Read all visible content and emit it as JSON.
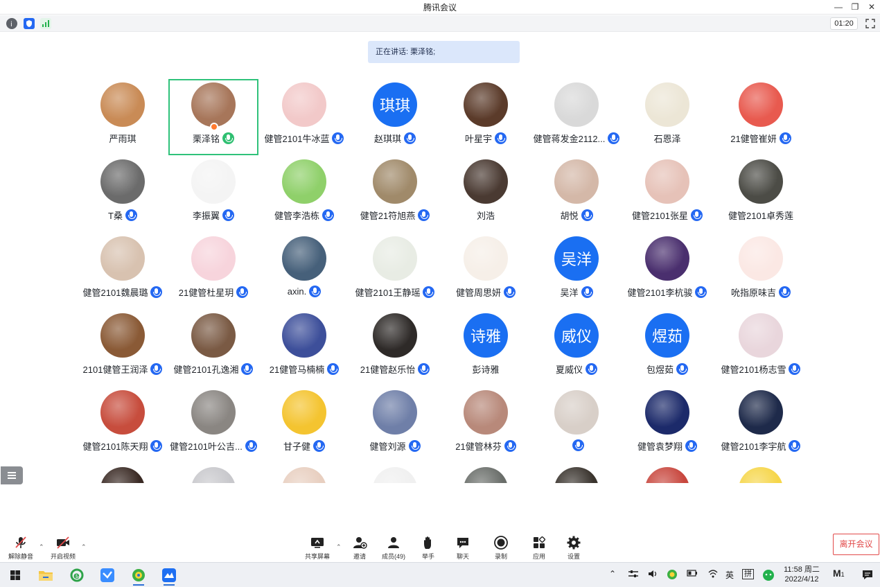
{
  "window": {
    "title": "腾讯会议"
  },
  "status": {
    "timer": "01:20"
  },
  "speaking": {
    "text": "正在讲话: 栗泽铭;"
  },
  "participants": [
    {
      "name": "严雨琪",
      "avatar": "photo",
      "color": "#c98b56",
      "mic": false
    },
    {
      "name": "栗泽铭",
      "avatar": "photo",
      "color": "#a7765a",
      "mic": true,
      "speaking": true,
      "active": true
    },
    {
      "name": "健管2101牛冰蓝",
      "avatar": "photo",
      "color": "#f2c9c9",
      "mic": true
    },
    {
      "name": "赵琪琪",
      "avatar": "text",
      "text": "琪琪",
      "color": "#1a6ff2",
      "mic": true
    },
    {
      "name": "叶星宇",
      "avatar": "photo",
      "color": "#5b3b2a",
      "mic": true
    },
    {
      "name": "健管蒋发金2112...",
      "avatar": "photo",
      "color": "#d9d9d9",
      "mic": true
    },
    {
      "name": "石恩泽",
      "avatar": "photo",
      "color": "#ece6d6",
      "mic": false
    },
    {
      "name": "21健管崔妍",
      "avatar": "photo",
      "color": "#e85a4f",
      "mic": true
    },
    {
      "name": "T桑",
      "avatar": "photo",
      "color": "#6b6b6b",
      "mic": true
    },
    {
      "name": "李振翼",
      "avatar": "photo",
      "color": "#f4f4f4",
      "mic": true
    },
    {
      "name": "健管李浩栋",
      "avatar": "photo",
      "color": "#8fd06a",
      "mic": true
    },
    {
      "name": "健管21符旭燕",
      "avatar": "photo",
      "color": "#a08a6a",
      "mic": true
    },
    {
      "name": "刘浩",
      "avatar": "photo",
      "color": "#4a3a32",
      "mic": false
    },
    {
      "name": "胡悦",
      "avatar": "photo",
      "color": "#d4b8a8",
      "mic": true
    },
    {
      "name": "健管2101张星",
      "avatar": "photo",
      "color": "#e6c2b8",
      "mic": true
    },
    {
      "name": "健管2101卓秀莲",
      "avatar": "photo",
      "color": "#4c4c46",
      "mic": false
    },
    {
      "name": "健管2101魏晨璐",
      "avatar": "photo",
      "color": "#d8c2b0",
      "mic": true
    },
    {
      "name": "21健管杜星玥",
      "avatar": "photo",
      "color": "#f7d4dc",
      "mic": true
    },
    {
      "name": "axin.",
      "avatar": "photo",
      "color": "#46607a",
      "mic": true
    },
    {
      "name": "健管2101王静瑶",
      "avatar": "photo",
      "color": "#e8ece4",
      "mic": true
    },
    {
      "name": "健管周思妍",
      "avatar": "photo",
      "color": "#f6efe8",
      "mic": true
    },
    {
      "name": "吴洋",
      "avatar": "text",
      "text": "吴洋",
      "color": "#1a6ff2",
      "mic": true
    },
    {
      "name": "健管2101李杭骏",
      "avatar": "photo",
      "color": "#4a2f6e",
      "mic": true
    },
    {
      "name": "吮指原味吉",
      "avatar": "photo",
      "color": "#fbe8e4",
      "mic": true
    },
    {
      "name": "2101健管王润泽",
      "avatar": "photo",
      "color": "#8a5a36",
      "mic": true
    },
    {
      "name": "健管2101孔逸湘",
      "avatar": "photo",
      "color": "#7a5a44",
      "mic": true
    },
    {
      "name": "21健管马楠楠",
      "avatar": "photo",
      "color": "#3d4f9a",
      "mic": true
    },
    {
      "name": "21健管赵乐怡",
      "avatar": "photo",
      "color": "#2e2a28",
      "mic": true
    },
    {
      "name": "彭诗雅",
      "avatar": "text",
      "text": "诗雅",
      "color": "#1a6ff2",
      "mic": false
    },
    {
      "name": "夏威仪",
      "avatar": "text",
      "text": "威仪",
      "color": "#1a6ff2",
      "mic": true
    },
    {
      "name": "包煜茹",
      "avatar": "text",
      "text": "煜茹",
      "color": "#1a6ff2",
      "mic": true
    },
    {
      "name": "健管2101杨志雪",
      "avatar": "photo",
      "color": "#e9d6dc",
      "mic": true
    },
    {
      "name": "健管2101陈天翔",
      "avatar": "photo",
      "color": "#c74d3d",
      "mic": true
    },
    {
      "name": "健管2101叶公吉...",
      "avatar": "photo",
      "color": "#8a8682",
      "mic": true
    },
    {
      "name": "甘子健",
      "avatar": "photo",
      "color": "#f4c430",
      "mic": true
    },
    {
      "name": "健管刘源",
      "avatar": "photo",
      "color": "#6f7fa8",
      "mic": true
    },
    {
      "name": "21健管林芬",
      "avatar": "photo",
      "color": "#b8897a",
      "mic": true
    },
    {
      "name": "",
      "avatar": "photo",
      "color": "#d8cfc8",
      "mic": true
    },
    {
      "name": "健管袁梦翔",
      "avatar": "photo",
      "color": "#1c2a6a",
      "mic": true,
      "micSolid": true
    },
    {
      "name": "健管2101李宇航",
      "avatar": "photo",
      "color": "#1e2a4a",
      "mic": true
    },
    {
      "name": "",
      "avatar": "photo",
      "color": "#3a2a24",
      "mic": false
    },
    {
      "name": "",
      "avatar": "photo",
      "color": "#c8c8cc",
      "mic": false
    },
    {
      "name": "",
      "avatar": "photo",
      "color": "#e8cfc0",
      "mic": false
    },
    {
      "name": "",
      "avatar": "photo",
      "color": "#f0f0f0",
      "mic": false
    },
    {
      "name": "",
      "avatar": "photo",
      "color": "#6a6e6a",
      "mic": false
    },
    {
      "name": "",
      "avatar": "photo",
      "color": "#3a342e",
      "mic": false
    },
    {
      "name": "",
      "avatar": "photo",
      "color": "#c8473e",
      "mic": false
    },
    {
      "name": "",
      "avatar": "photo",
      "color": "#f6d64a",
      "mic": false
    }
  ],
  "toolbar": {
    "unmute": "解除静音",
    "start_video": "开启视频",
    "share": "共享屏幕",
    "invite": "邀请",
    "members": "成员(49)",
    "raise_hand": "举手",
    "chat": "聊天",
    "record": "录制",
    "apps": "应用",
    "settings": "设置",
    "leave": "离开会议"
  },
  "taskbar": {
    "lang": "英",
    "ime": "拼",
    "time": "11:58 周二",
    "date": "2022/4/12",
    "notif_count": "1"
  }
}
